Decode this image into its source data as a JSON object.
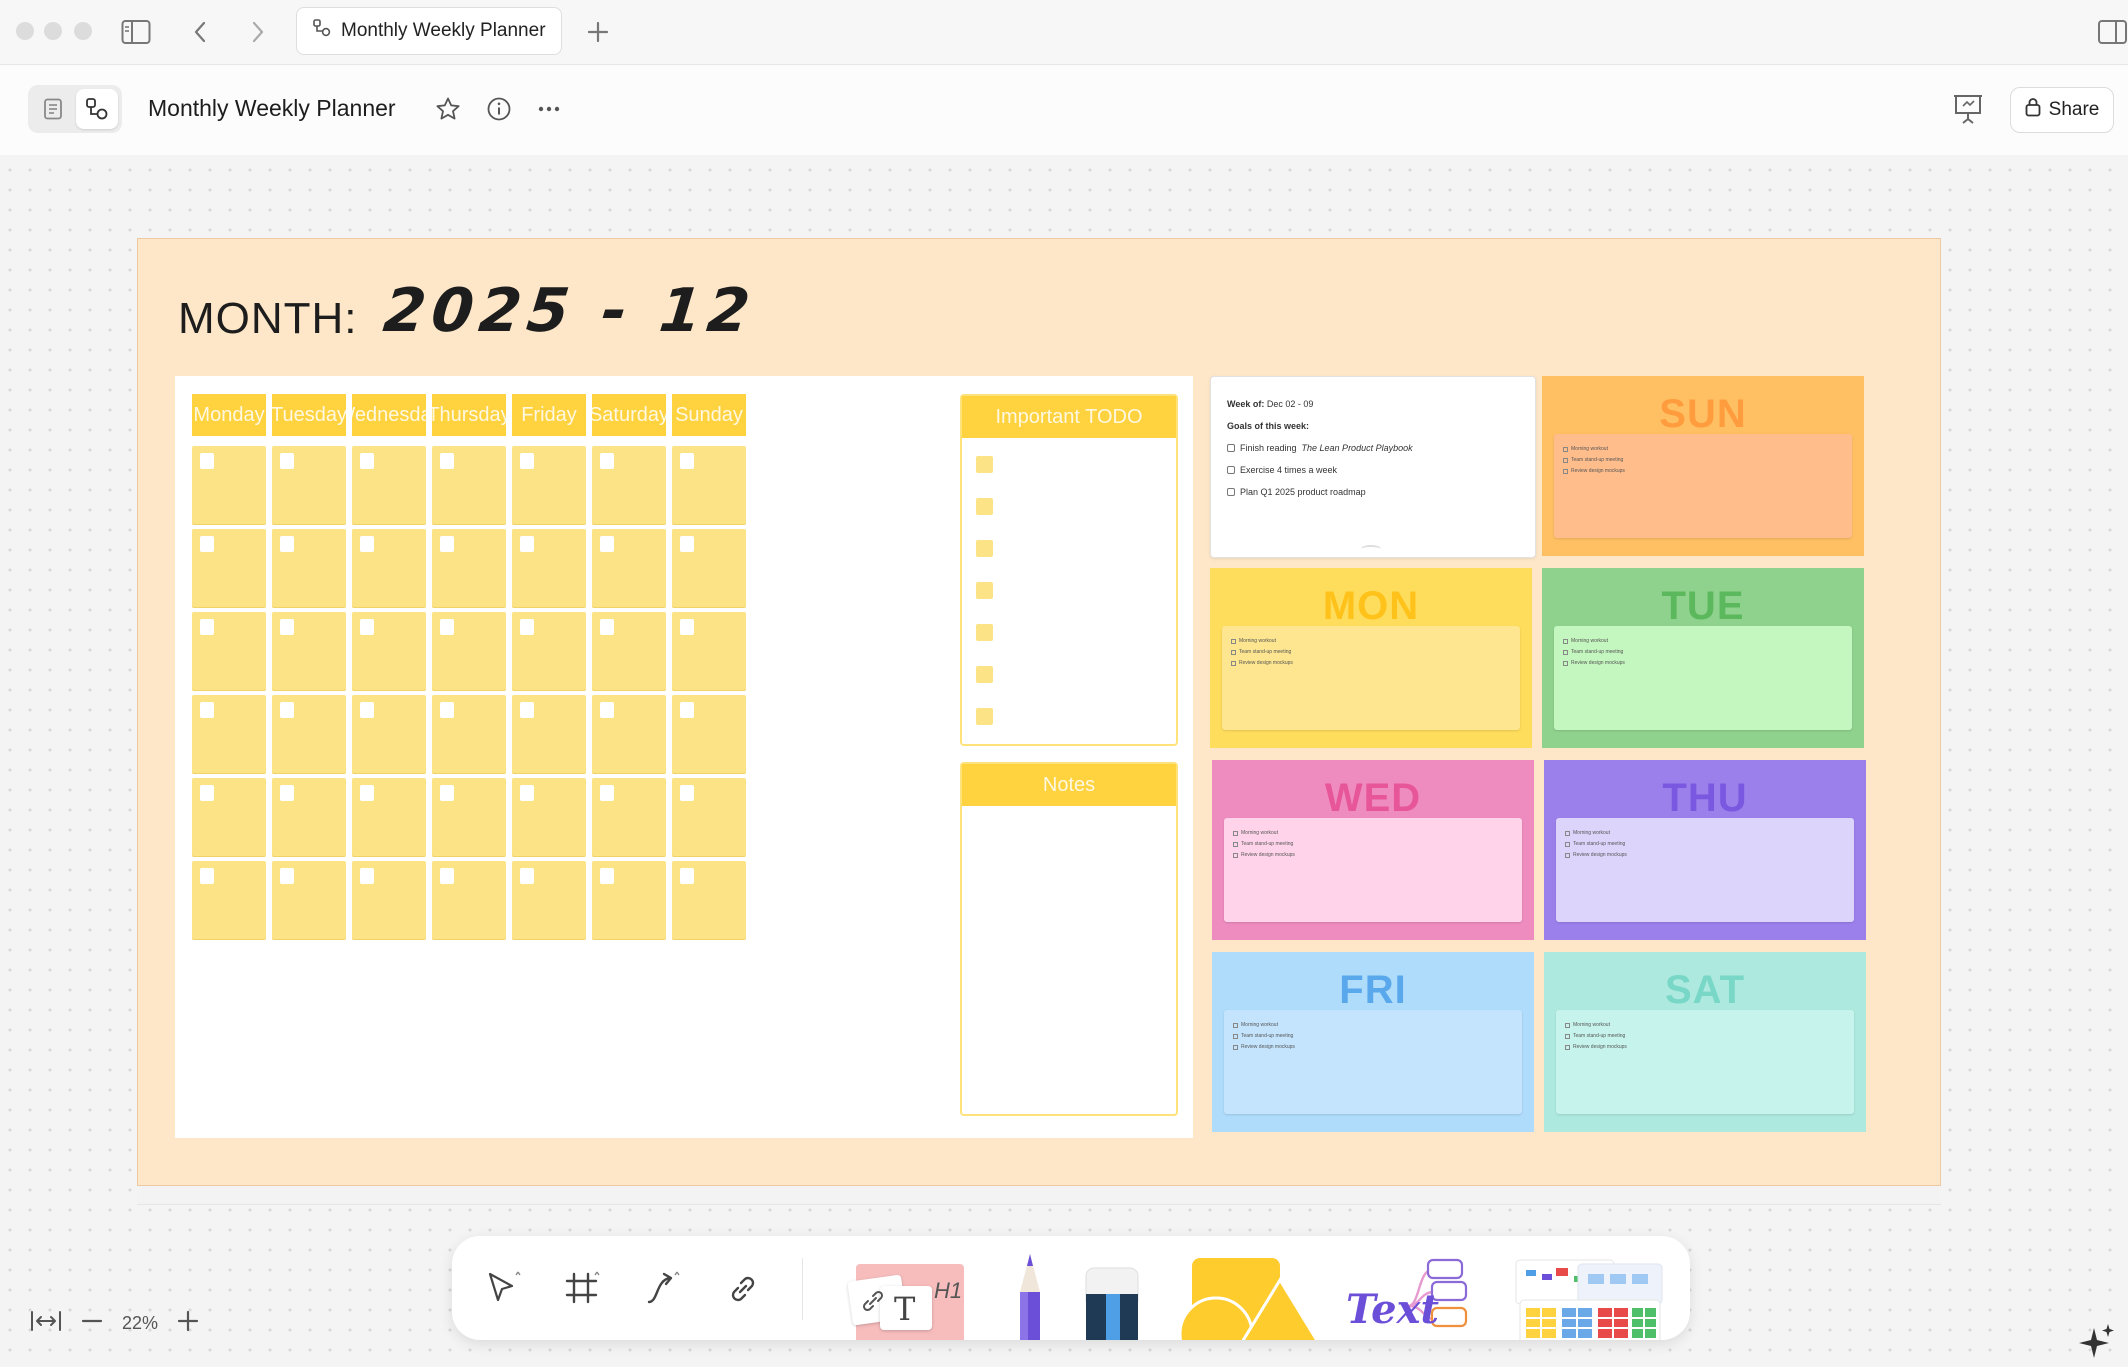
{
  "window": {
    "tab_title": "Monthly Weekly Planner",
    "icons": [
      "sidebar-icon",
      "back-icon",
      "forward-icon",
      "whiteboard-icon",
      "new-tab-icon",
      "split-view-icon"
    ]
  },
  "header": {
    "title": "Monthly Weekly Planner",
    "share_label": "Share",
    "icons": [
      "page-mode-icon",
      "edgeless-mode-icon",
      "star-icon",
      "info-icon",
      "more-icon",
      "presentation-icon",
      "lock-icon"
    ]
  },
  "planner": {
    "month_label": "MONTH:",
    "month_value": "2025 - 12",
    "weekdays": [
      "Monday",
      "Tuesday",
      "Wednesday",
      "Thursday",
      "Friday",
      "Saturday",
      "Sunday"
    ],
    "todo_title": "Important TODO",
    "notes_title": "Notes",
    "colors": {
      "board": "#fde7c8",
      "header": "#ffd23f",
      "cell": "#fbe386"
    }
  },
  "weekly": {
    "week_label": "Week of:",
    "week_range": "Dec 02 - 09",
    "goals_title": "Goals of this week:",
    "goals": [
      {
        "prefix": "Finish reading ",
        "emphasis": "The Lean Product Playbook"
      },
      {
        "prefix": "Exercise 4 times a week",
        "emphasis": ""
      },
      {
        "prefix": "Plan Q1 2025 product roadmap",
        "emphasis": ""
      }
    ],
    "days": [
      {
        "label": "SUN",
        "bg": "#ffc064",
        "fg": "#ff9c3e",
        "note": "#ffbd8c"
      },
      {
        "label": "MON",
        "bg": "#ffdd5c",
        "fg": "#ffc21a",
        "note": "#fde68f"
      },
      {
        "label": "TUE",
        "bg": "#8fd28e",
        "fg": "#5cb85c",
        "note": "#c4f6bf"
      },
      {
        "label": "WED",
        "bg": "#ee8cc0",
        "fg": "#e8569a",
        "note": "#ffd4ea"
      },
      {
        "label": "THU",
        "bg": "#9b80ec",
        "fg": "#7a58e0",
        "note": "#dcd4fb"
      },
      {
        "label": "FRI",
        "bg": "#afdcfb",
        "fg": "#5aa8ec",
        "note": "#c4e4fd"
      },
      {
        "label": "SAT",
        "bg": "#aee9df",
        "fg": "#78d7c6",
        "note": "#c6f4ec"
      }
    ],
    "routine": [
      "Morning workout",
      "Team stand-up meeting",
      "Review design mockups"
    ]
  },
  "toolbar": {
    "tools": [
      "pointer-icon",
      "frame-icon",
      "connector-icon",
      "link-icon",
      "note-card-icon",
      "pen-icon",
      "eraser-icon",
      "shape-icon",
      "mindmap-icon",
      "template-icon"
    ],
    "text_sample": "Text",
    "heading_sample": "H1"
  },
  "zoom": {
    "level": "22%"
  }
}
